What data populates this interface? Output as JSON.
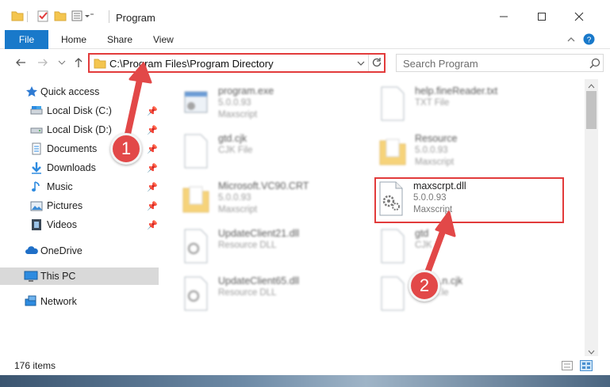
{
  "window": {
    "title": "Program",
    "controls": {
      "minimize": "—",
      "maximize": "☐",
      "close": "✕"
    }
  },
  "ribbon": {
    "tabs": [
      "File",
      "Home",
      "Share",
      "View"
    ]
  },
  "address": {
    "path": "C:\\Program Files\\Program Directory",
    "search_placeholder": "Search Program"
  },
  "nav": {
    "quick_access": "Quick access",
    "items": [
      {
        "label": "Local Disk (C:)",
        "icon": "drive-icon"
      },
      {
        "label": "Local Disk (D:)",
        "icon": "drive-icon"
      },
      {
        "label": "Documents",
        "icon": "documents-icon"
      },
      {
        "label": "Downloads",
        "icon": "downloads-icon"
      },
      {
        "label": "Music",
        "icon": "music-icon"
      },
      {
        "label": "Pictures",
        "icon": "pictures-icon"
      },
      {
        "label": "Videos",
        "icon": "videos-icon"
      }
    ],
    "onedrive": "OneDrive",
    "this_pc": "This PC",
    "network": "Network"
  },
  "files": [
    {
      "name": "program.exe",
      "line2": "5.0.0.93",
      "line3": "Maxscript",
      "icon": "exe-icon"
    },
    {
      "name": "help.fineReader.txt",
      "line2": "TXT File",
      "line3": "",
      "icon": "text-file-icon"
    },
    {
      "name": "gtd.cjk",
      "line2": "CJK File",
      "line3": "",
      "icon": "file-icon"
    },
    {
      "name": "Resource",
      "line2": "5.0.0.93",
      "line3": "Maxscript",
      "icon": "folder-icon"
    },
    {
      "name": "Microsoft.VC90.CRT",
      "line2": "5.0.0.93",
      "line3": "Maxscript",
      "icon": "folder-icon"
    },
    {
      "name": "maxscrpt.dll",
      "line2": "5.0.0.93",
      "line3": "Maxscript",
      "icon": "dll-icon"
    },
    {
      "name": "UpdateClient21.dll",
      "line2": "Resource DLL",
      "line3": "",
      "icon": "dll-icon"
    },
    {
      "name": "gtd",
      "line2": "CJK",
      "line3": "",
      "icon": "file-icon"
    },
    {
      "name": "UpdateClient65.dll",
      "line2": "Resource DLL",
      "line3": "",
      "icon": "dll-icon"
    },
    {
      "name": "...n.cjk",
      "line2": "...le",
      "line3": "",
      "icon": "file-icon"
    }
  ],
  "status": {
    "item_count": "176 items"
  },
  "annotations": {
    "step1": "1",
    "step2": "2"
  },
  "colors": {
    "accent": "#1979ca",
    "highlight": "#e23b3b",
    "folder": "#f4c54e"
  }
}
